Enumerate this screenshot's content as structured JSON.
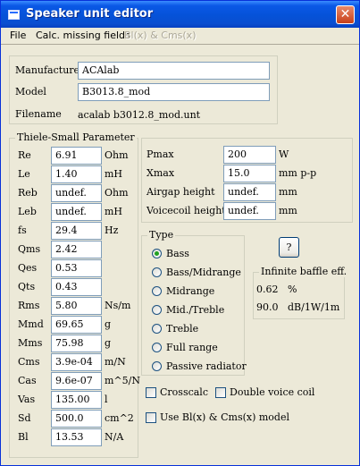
{
  "window": {
    "title": "Speaker unit editor",
    "close_glyph": "✕"
  },
  "menu": [
    "File",
    "Calc. missing fields",
    "Bl(x) & Cms(x)"
  ],
  "info": {
    "manufacturer_label": "Manufacturer",
    "manufacturer_value": "ACAlab",
    "model_label": "Model",
    "model_value": "B3013.8_mod",
    "filename_label": "Filename",
    "filename_value": "acalab b3012.8_mod.unt"
  },
  "ts": {
    "title": "Thiele-Small Parameter",
    "rows": [
      {
        "label": "Re",
        "value": "6.91",
        "unit": "Ohm"
      },
      {
        "label": "Le",
        "value": "1.40",
        "unit": "mH"
      },
      {
        "label": "Reb",
        "value": "undef.",
        "unit": "Ohm"
      },
      {
        "label": "Leb",
        "value": "undef.",
        "unit": "mH"
      },
      {
        "label": "fs",
        "value": "29.4",
        "unit": "Hz"
      },
      {
        "label": "Qms",
        "value": "2.42",
        "unit": ""
      },
      {
        "label": "Qes",
        "value": "0.53",
        "unit": ""
      },
      {
        "label": "Qts",
        "value": "0.43",
        "unit": ""
      },
      {
        "label": "Rms",
        "value": "5.80",
        "unit": "Ns/m"
      },
      {
        "label": "Mmd",
        "value": "69.65",
        "unit": "g"
      },
      {
        "label": "Mms",
        "value": "75.98",
        "unit": "g"
      },
      {
        "label": "Cms",
        "value": "3.9e-04",
        "unit": "m/N"
      },
      {
        "label": "Cas",
        "value": "9.6e-07",
        "unit": "m^5/N"
      },
      {
        "label": "Vas",
        "value": "135.00",
        "unit": "l"
      },
      {
        "label": "Sd",
        "value": "500.0",
        "unit": "cm^2"
      },
      {
        "label": "Bl",
        "value": "13.53",
        "unit": "N/A"
      }
    ]
  },
  "power": {
    "rows": [
      {
        "label": "Pmax",
        "value": "200",
        "unit": "W"
      },
      {
        "label": "Xmax",
        "value": "15.0",
        "unit": "mm p-p"
      },
      {
        "label": "Airgap height",
        "value": "undef.",
        "unit": "mm"
      },
      {
        "label": "Voicecoil height",
        "value": "undef.",
        "unit": "mm"
      }
    ]
  },
  "type": {
    "title": "Type",
    "selected": 0,
    "options": [
      "Bass",
      "Bass/Midrange",
      "Midrange",
      "Mid./Treble",
      "Treble",
      "Full range",
      "Passive radiator"
    ]
  },
  "help_button": "?",
  "infinite_baffle": {
    "title": "Infinite baffle eff.",
    "row1_value": "0.62",
    "row1_unit": "%",
    "row2_value": "90.0",
    "row2_unit": "dB/1W/1m"
  },
  "checks": {
    "crosscalc": "Crosscalc",
    "double_voice_coil": "Double voice coil",
    "use_blx": "Use Bl(x) & Cms(x) model"
  }
}
